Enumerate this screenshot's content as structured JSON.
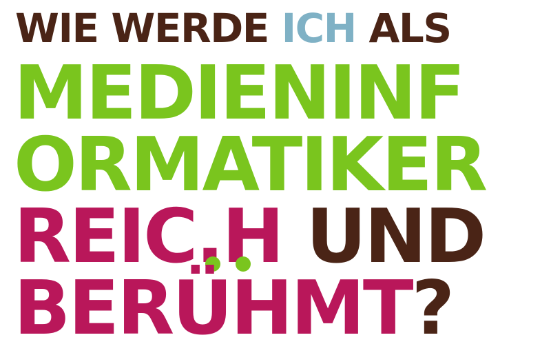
{
  "colors": {
    "brown": "#4a2416",
    "blue": "#7fb1c5",
    "green": "#7ac51e",
    "magenta": "#b9175a"
  },
  "line1": {
    "part1": "WIE WERDE ",
    "part2": "ICH",
    "part3": " ALS"
  },
  "line2": "MEDIENINF",
  "line3": "ORMATIKER",
  "line4": {
    "part1": "REIC",
    "part2": ".",
    "part3": "H ",
    "part4": "UND"
  },
  "line5": {
    "part1": "BERÜHMT",
    "part2": "?"
  }
}
